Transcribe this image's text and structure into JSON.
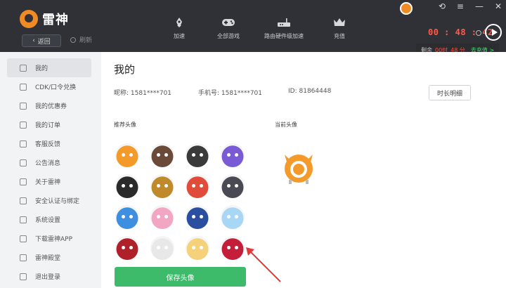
{
  "app": {
    "name": "雷神"
  },
  "header": {
    "back_label": "返回",
    "refresh_label": "刷新",
    "nav": [
      {
        "label": "加速",
        "icon": "rocket-icon"
      },
      {
        "label": "全部游戏",
        "icon": "gamepad-icon"
      },
      {
        "label": "路由硬件级加速",
        "icon": "router-icon"
      },
      {
        "label": "充值",
        "icon": "crown-icon"
      }
    ],
    "timer": "00 : 48 : 42",
    "remain": {
      "prefix": "剩余",
      "hours": "00时",
      "minutes": "48 分",
      "action": "去充值 >"
    }
  },
  "sidebar": {
    "items": [
      {
        "label": "我的",
        "icon": "home-icon",
        "active": true
      },
      {
        "label": "CDK/口令兑换",
        "icon": "gift-icon"
      },
      {
        "label": "我的优惠券",
        "icon": "coupon-icon"
      },
      {
        "label": "我的订单",
        "icon": "order-icon"
      },
      {
        "label": "客服反馈",
        "icon": "support-icon"
      },
      {
        "label": "公告消息",
        "icon": "speaker-icon"
      },
      {
        "label": "关于雷神",
        "icon": "info-icon"
      },
      {
        "label": "安全认证与绑定",
        "icon": "shield-icon"
      },
      {
        "label": "系统设置",
        "icon": "gear-icon"
      },
      {
        "label": "下载雷神APP",
        "icon": "phone-icon"
      },
      {
        "label": "雷神殿堂",
        "icon": "leaf-icon"
      },
      {
        "label": "退出登录",
        "icon": "logout-icon"
      }
    ]
  },
  "main": {
    "title": "我的",
    "nickname_label": "昵称:",
    "nickname": "1581****701",
    "phone_label": "手机号:",
    "phone": "1581****701",
    "id_label": "ID:",
    "id": "81864448",
    "duration_btn": "时长明细",
    "recommended_label": "推荐头像",
    "current_label": "当前头像",
    "save_label": "保存头像",
    "avatars": [
      {
        "name": "orange-mascot",
        "color": "#f39a2b"
      },
      {
        "name": "dark-hood",
        "color": "#6b4a3a"
      },
      {
        "name": "panda",
        "color": "#3a3a3a"
      },
      {
        "name": "purple-hero",
        "color": "#7a5bd6"
      },
      {
        "name": "black-ninja",
        "color": "#2a2a2a"
      },
      {
        "name": "gold-warrior",
        "color": "#c08a2a"
      },
      {
        "name": "red-bird",
        "color": "#e04b3a"
      },
      {
        "name": "goggles",
        "color": "#4a4a55"
      },
      {
        "name": "blue-robot",
        "color": "#3f8fe0"
      },
      {
        "name": "pink-girl",
        "color": "#f2a6c2"
      },
      {
        "name": "blue-captain",
        "color": "#2b4fa0"
      },
      {
        "name": "ice-cat",
        "color": "#a8d6f5"
      },
      {
        "name": "red-demon",
        "color": "#b0202a"
      },
      {
        "name": "white-bunny",
        "color": "#e8e8e8"
      },
      {
        "name": "blonde-kid",
        "color": "#f5d27a"
      },
      {
        "name": "red-devil",
        "color": "#c41e3a"
      }
    ]
  }
}
